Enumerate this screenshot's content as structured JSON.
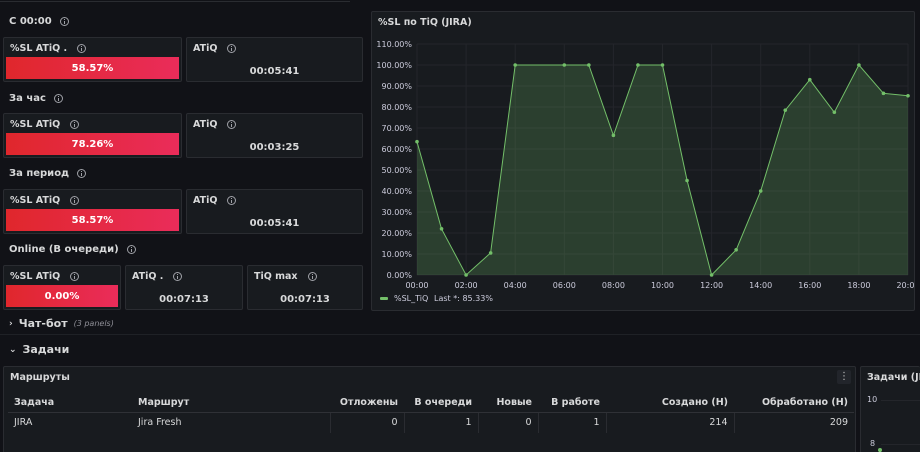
{
  "rows": {
    "now": "С 00:00",
    "hour": "За час",
    "period": "За период",
    "online": "Online (В очереди)"
  },
  "stats": {
    "now_sl_title": "%SL ATiQ .",
    "now_sl_value": "58.57%",
    "now_atiq_title": "ATiQ",
    "now_atiq_value": "00:05:41",
    "hour_sl_title": "%SL ATiQ",
    "hour_sl_value": "78.26%",
    "hour_atiq_title": "ATiQ",
    "hour_atiq_value": "00:03:25",
    "period_sl_title": "%SL ATiQ",
    "period_sl_value": "58.57%",
    "period_atiq_title": "ATiQ",
    "period_atiq_value": "00:05:41",
    "online_sl_title": "%SL ATiQ",
    "online_sl_value": "0.00%",
    "online_atiq_title": "ATiQ .",
    "online_atiq_value": "00:07:13",
    "online_tiqmax_title": "TiQ max",
    "online_tiqmax_value": "00:07:13"
  },
  "chart_panel": {
    "title": "%SL по TiQ (JIRA)",
    "legend_label": "%SL_TiQ",
    "legend_last": "Last *: 85.33%"
  },
  "sections": {
    "chatbot": "Чат-бот",
    "chatbot_sub": "(3 panels)",
    "tasks": "Задачи"
  },
  "routes_panel": {
    "title": "Маршруты",
    "menu": "⋮",
    "headers": [
      "Задача",
      "Маршрут",
      "Отложены",
      "В очереди",
      "Новые",
      "В работе",
      "Создано (Н)",
      "Обработано (Н)"
    ],
    "rows": [
      [
        "JIRA",
        "Jira Fresh",
        "0",
        "1",
        "0",
        "1",
        "214",
        "209"
      ]
    ]
  },
  "side_panel": {
    "title": "Задачи (JIR",
    "tick_top": "10",
    "tick_bottom": "8"
  },
  "colors": {
    "accent_red": "#e0272c",
    "line_green": "#73bf69",
    "panel_bg": "#181b1f"
  },
  "chart_data": {
    "type": "area",
    "title": "%SL по TiQ (JIRA)",
    "series": [
      {
        "name": "%SL_TiQ",
        "x": [
          "00:00",
          "01:00",
          "02:00",
          "03:00",
          "04:00",
          "06:00",
          "07:00",
          "08:00",
          "09:00",
          "10:00",
          "11:00",
          "12:00",
          "13:00",
          "14:00",
          "15:00",
          "16:00",
          "17:00",
          "18:00",
          "19:00",
          "20:00"
        ],
        "values": [
          63.5,
          22,
          0,
          10.5,
          100,
          100,
          100,
          66.5,
          100,
          100,
          45,
          0,
          12,
          40,
          78.5,
          93,
          77.5,
          100,
          86.5,
          85.33
        ]
      }
    ],
    "x_ticks": [
      "00:00",
      "02:00",
      "04:00",
      "06:00",
      "08:00",
      "10:00",
      "12:00",
      "14:00",
      "16:00",
      "18:00",
      "20:00"
    ],
    "y_ticks": [
      "0.00%",
      "10.00%",
      "20.00%",
      "30.00%",
      "40.00%",
      "50.00%",
      "60.00%",
      "70.00%",
      "80.00%",
      "90.00%",
      "100.00%",
      "110.00%"
    ],
    "ylim": [
      0,
      110
    ],
    "grid": true,
    "legend": "bottom-left"
  }
}
